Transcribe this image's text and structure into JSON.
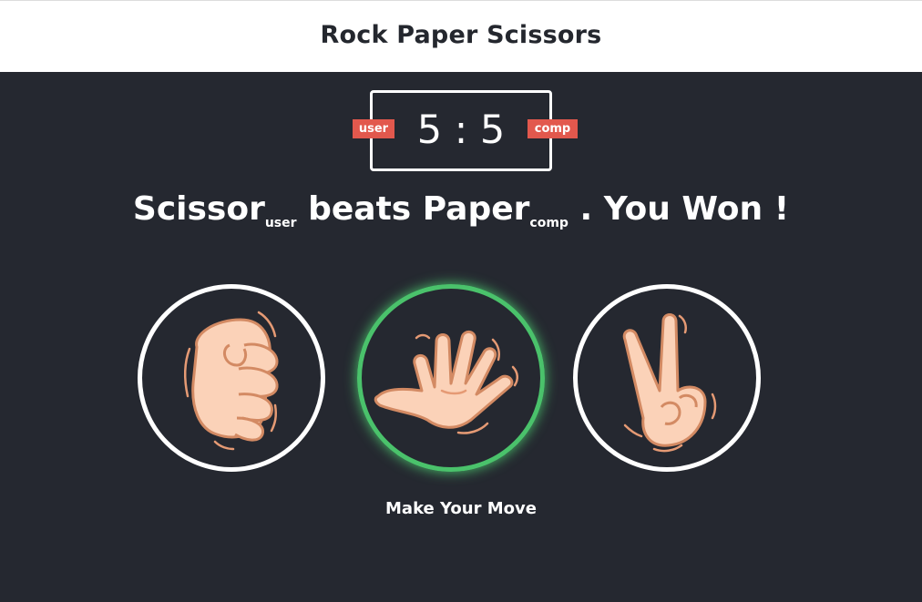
{
  "header": {
    "title": "Rock Paper Scissors"
  },
  "scoreboard": {
    "score_text": "5 : 5",
    "user_label": "user",
    "comp_label": "comp",
    "badge_color": "#e2584d"
  },
  "result": {
    "user_choice": "Scissor",
    "user_tag": "user",
    "middle": "beats",
    "comp_choice": "Paper",
    "comp_tag": "comp",
    "outcome": ". You Won !"
  },
  "choices": [
    {
      "id": "rock",
      "icon": "rock-hand-icon",
      "highlighted": false
    },
    {
      "id": "paper",
      "icon": "paper-hand-icon",
      "highlighted": true,
      "highlight_color": "#4ac26b"
    },
    {
      "id": "scissors",
      "icon": "scissors-hand-icon",
      "highlighted": false
    }
  ],
  "prompt": "Make Your Move",
  "colors": {
    "background": "#252830",
    "header_bg": "#ffffff"
  }
}
